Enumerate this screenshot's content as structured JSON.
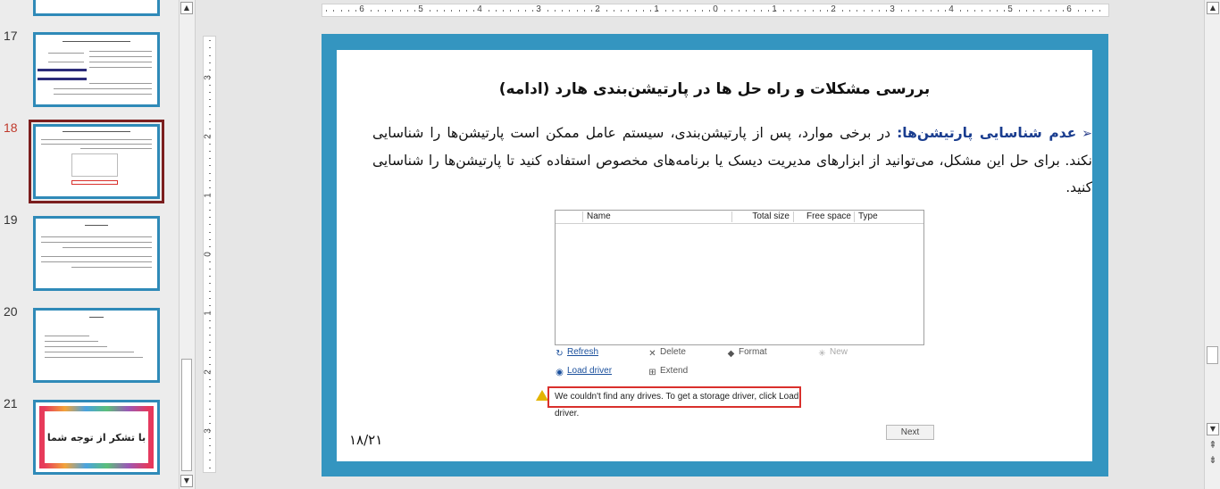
{
  "thumbnails": [
    {
      "number": "17",
      "title": "بررسی مشکلات و راه حل ها در پارتیشن‌بندی هارد (ادامه)"
    },
    {
      "number": "18",
      "title": "بررسی مشکلات و راه حل ها در پارتیشن‌بندی هارد (ادامه)",
      "selected": true
    },
    {
      "number": "19",
      "title": "جمع‌بندی"
    },
    {
      "number": "20",
      "title": "منابع"
    },
    {
      "number": "21",
      "title": "با تشکر از توجه شما"
    }
  ],
  "ruler": {
    "horizontal": [
      "6",
      "5",
      "4",
      "3",
      "2",
      "1",
      "0",
      "1",
      "2",
      "3",
      "4",
      "5",
      "6"
    ],
    "vertical": [
      "3",
      "2",
      "1",
      "0",
      "1",
      "2",
      "3"
    ]
  },
  "slide": {
    "title": "بررسی مشکلات و راه حل ها در پارتیشن‌بندی هارد (ادامه)",
    "bullet_symbol": "➢",
    "bullet_keyword": "عدم شناسایی پارتیشن‌ها:",
    "bullet_text": " در برخی موارد، پس از پارتیشن‌بندی، سیستم عامل ممکن است پارتیشن‌ها را شناسایی نکند. برای حل این مشکل، می‌توانید از ابزارهای مدیریت دیسک یا برنامه‌های مخصوص استفاده کنید تا پارتیشن‌ها را شناسایی کنید.",
    "page_number": "۱۸/۲۱"
  },
  "installer": {
    "columns": [
      "Name",
      "Total size",
      "Free space",
      "Type"
    ],
    "actions": {
      "refresh": "Refresh",
      "delete": "Delete",
      "format": "Format",
      "new": "New",
      "load_driver": "Load driver",
      "extend": "Extend"
    },
    "warning": "We couldn't find any drives. To get a storage driver, click Load driver.",
    "next": "Next"
  },
  "colors": {
    "slide_border": "#3495c0",
    "selected_thumbnail": "#7b1e1e",
    "warning_border": "#d9302c",
    "keyword": "#1a3d8f"
  }
}
